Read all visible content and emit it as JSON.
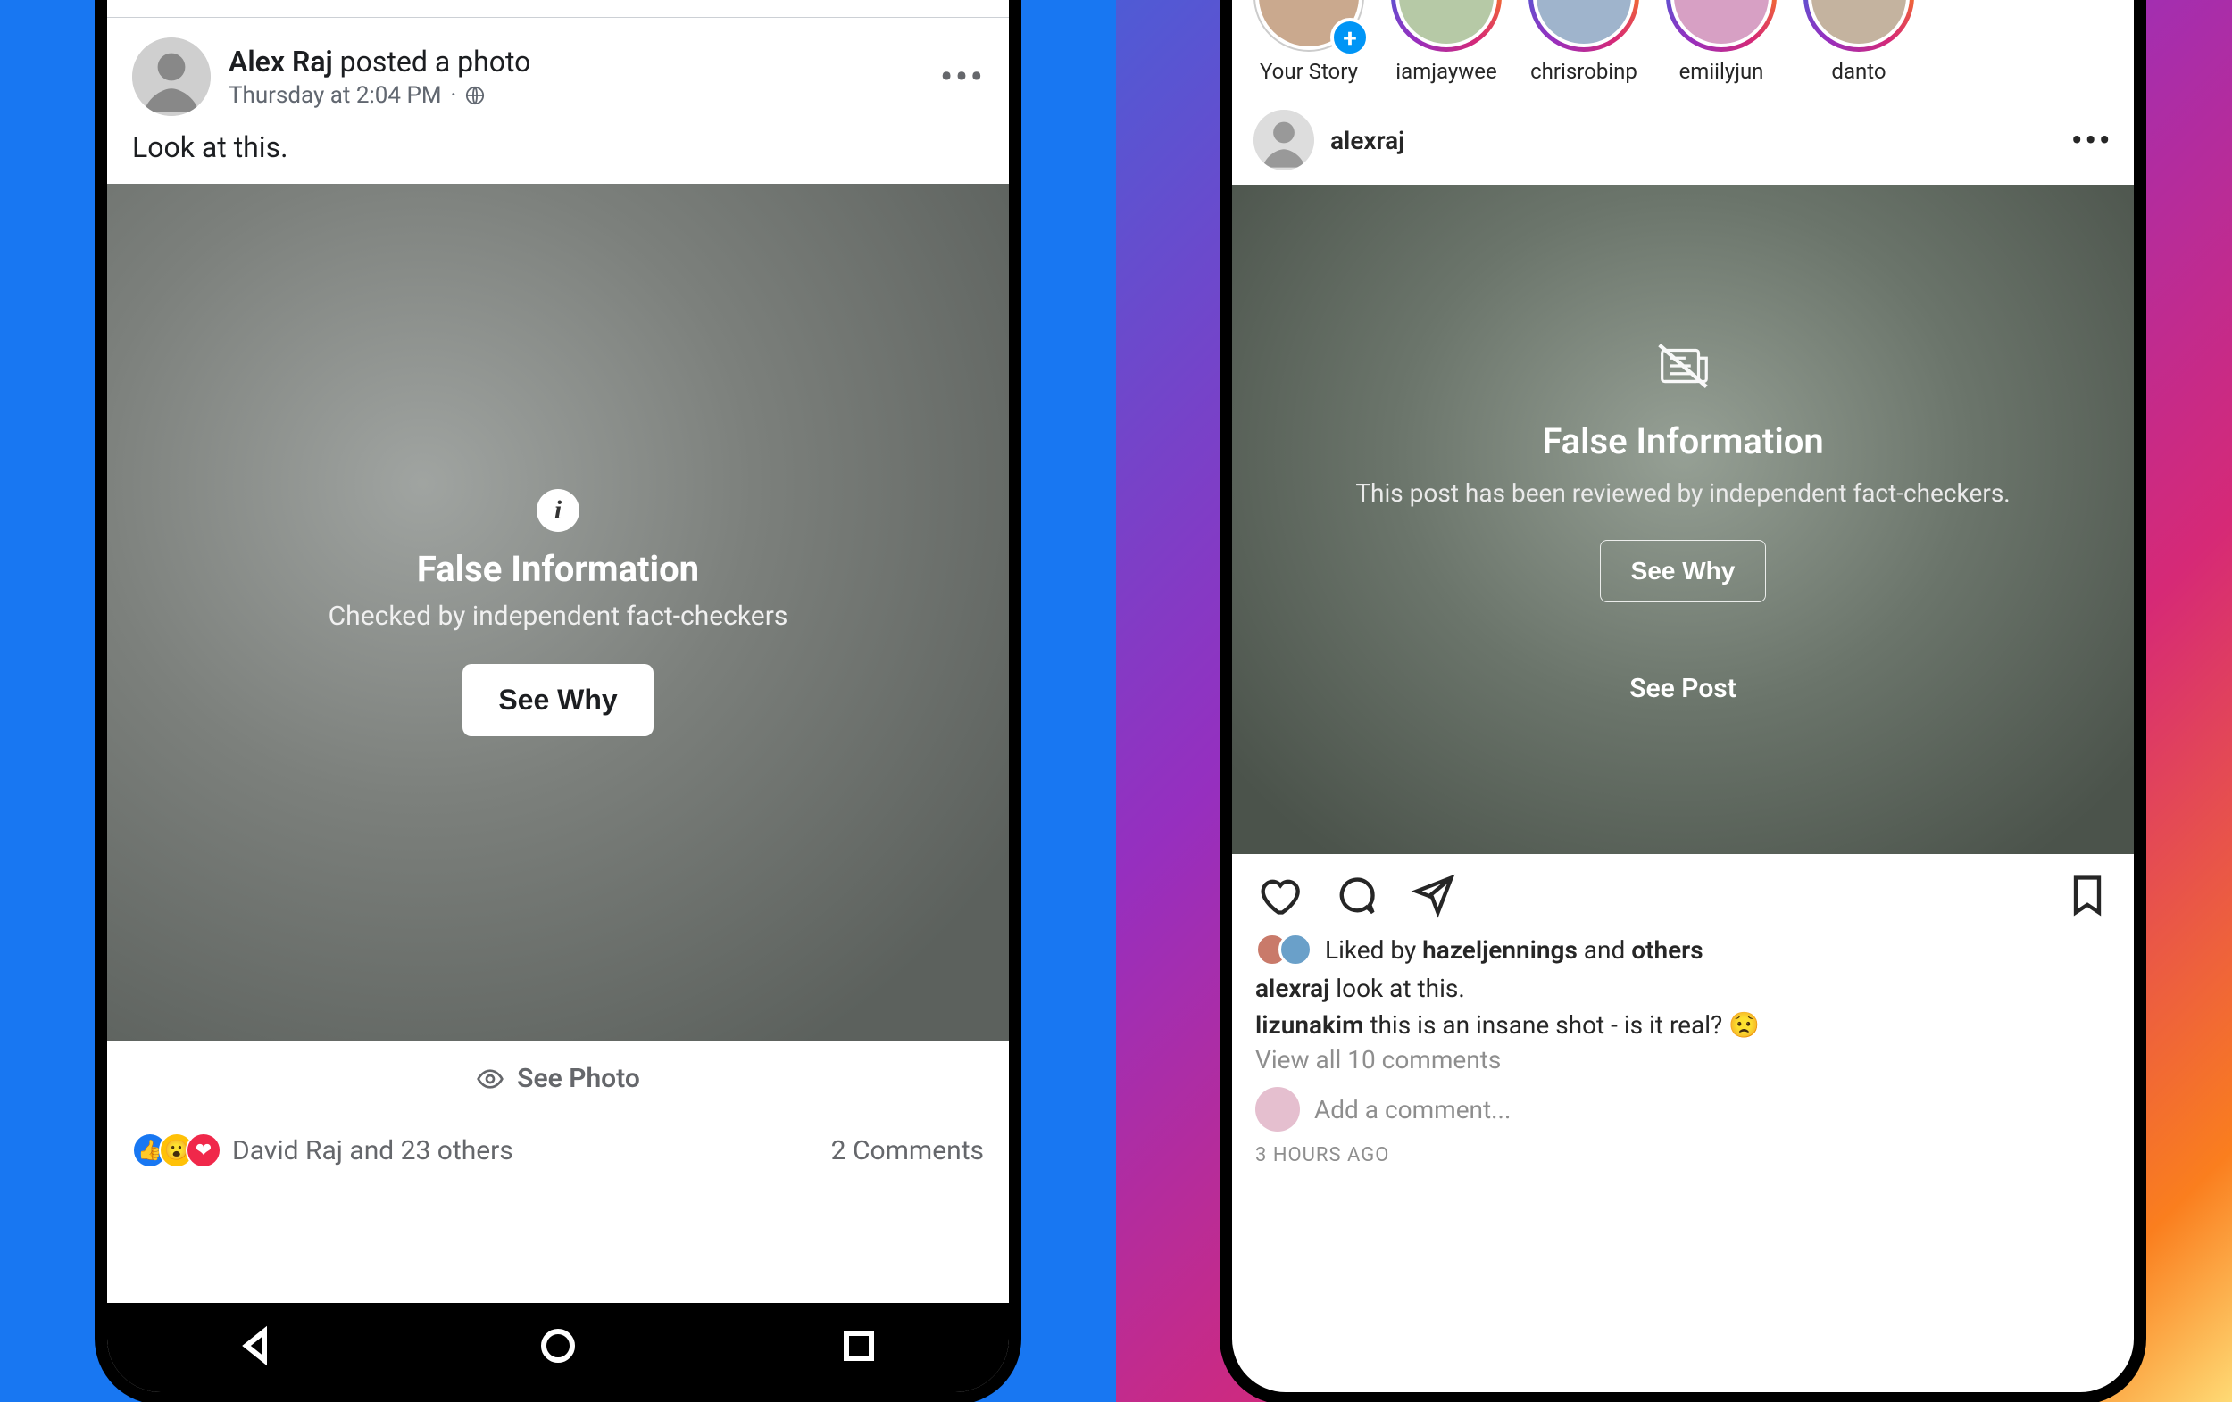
{
  "fb": {
    "author_name": "Alex Raj",
    "author_action": " posted a photo",
    "timestamp": "Thursday at 2:04 PM",
    "privacy": "Public",
    "caption": "Look at this.",
    "overlay": {
      "title": "False Information",
      "subtitle": "Checked by independent fact-checkers",
      "button": "See Why"
    },
    "see_photo": "See Photo",
    "reactions_text": "David Raj and 23 others",
    "comments": "2 Comments"
  },
  "ig": {
    "stories": [
      {
        "label": "Your Story",
        "has_add": true,
        "ringless": true
      },
      {
        "label": "iamjaywee"
      },
      {
        "label": "chrisrobinp"
      },
      {
        "label": "emiilyjun"
      },
      {
        "label": "danto"
      }
    ],
    "username": "alexraj",
    "overlay": {
      "title": "False Information",
      "subtitle": "This post has been reviewed by independent fact-checkers.",
      "button": "See Why",
      "see_post": "See Post"
    },
    "likes_prefix": "Liked by ",
    "likes_name": "hazeljennings",
    "likes_and": " and ",
    "likes_others": "others",
    "caption_user": "alexraj",
    "caption_text": " look at this.",
    "comment_user": "lizunakim",
    "comment_text": " this is an insane shot - is it real? ",
    "comment_emoji": "😟",
    "view_all": "View all 10 comments",
    "add_comment": "Add a comment...",
    "timeago": "3 HOURS AGO"
  }
}
